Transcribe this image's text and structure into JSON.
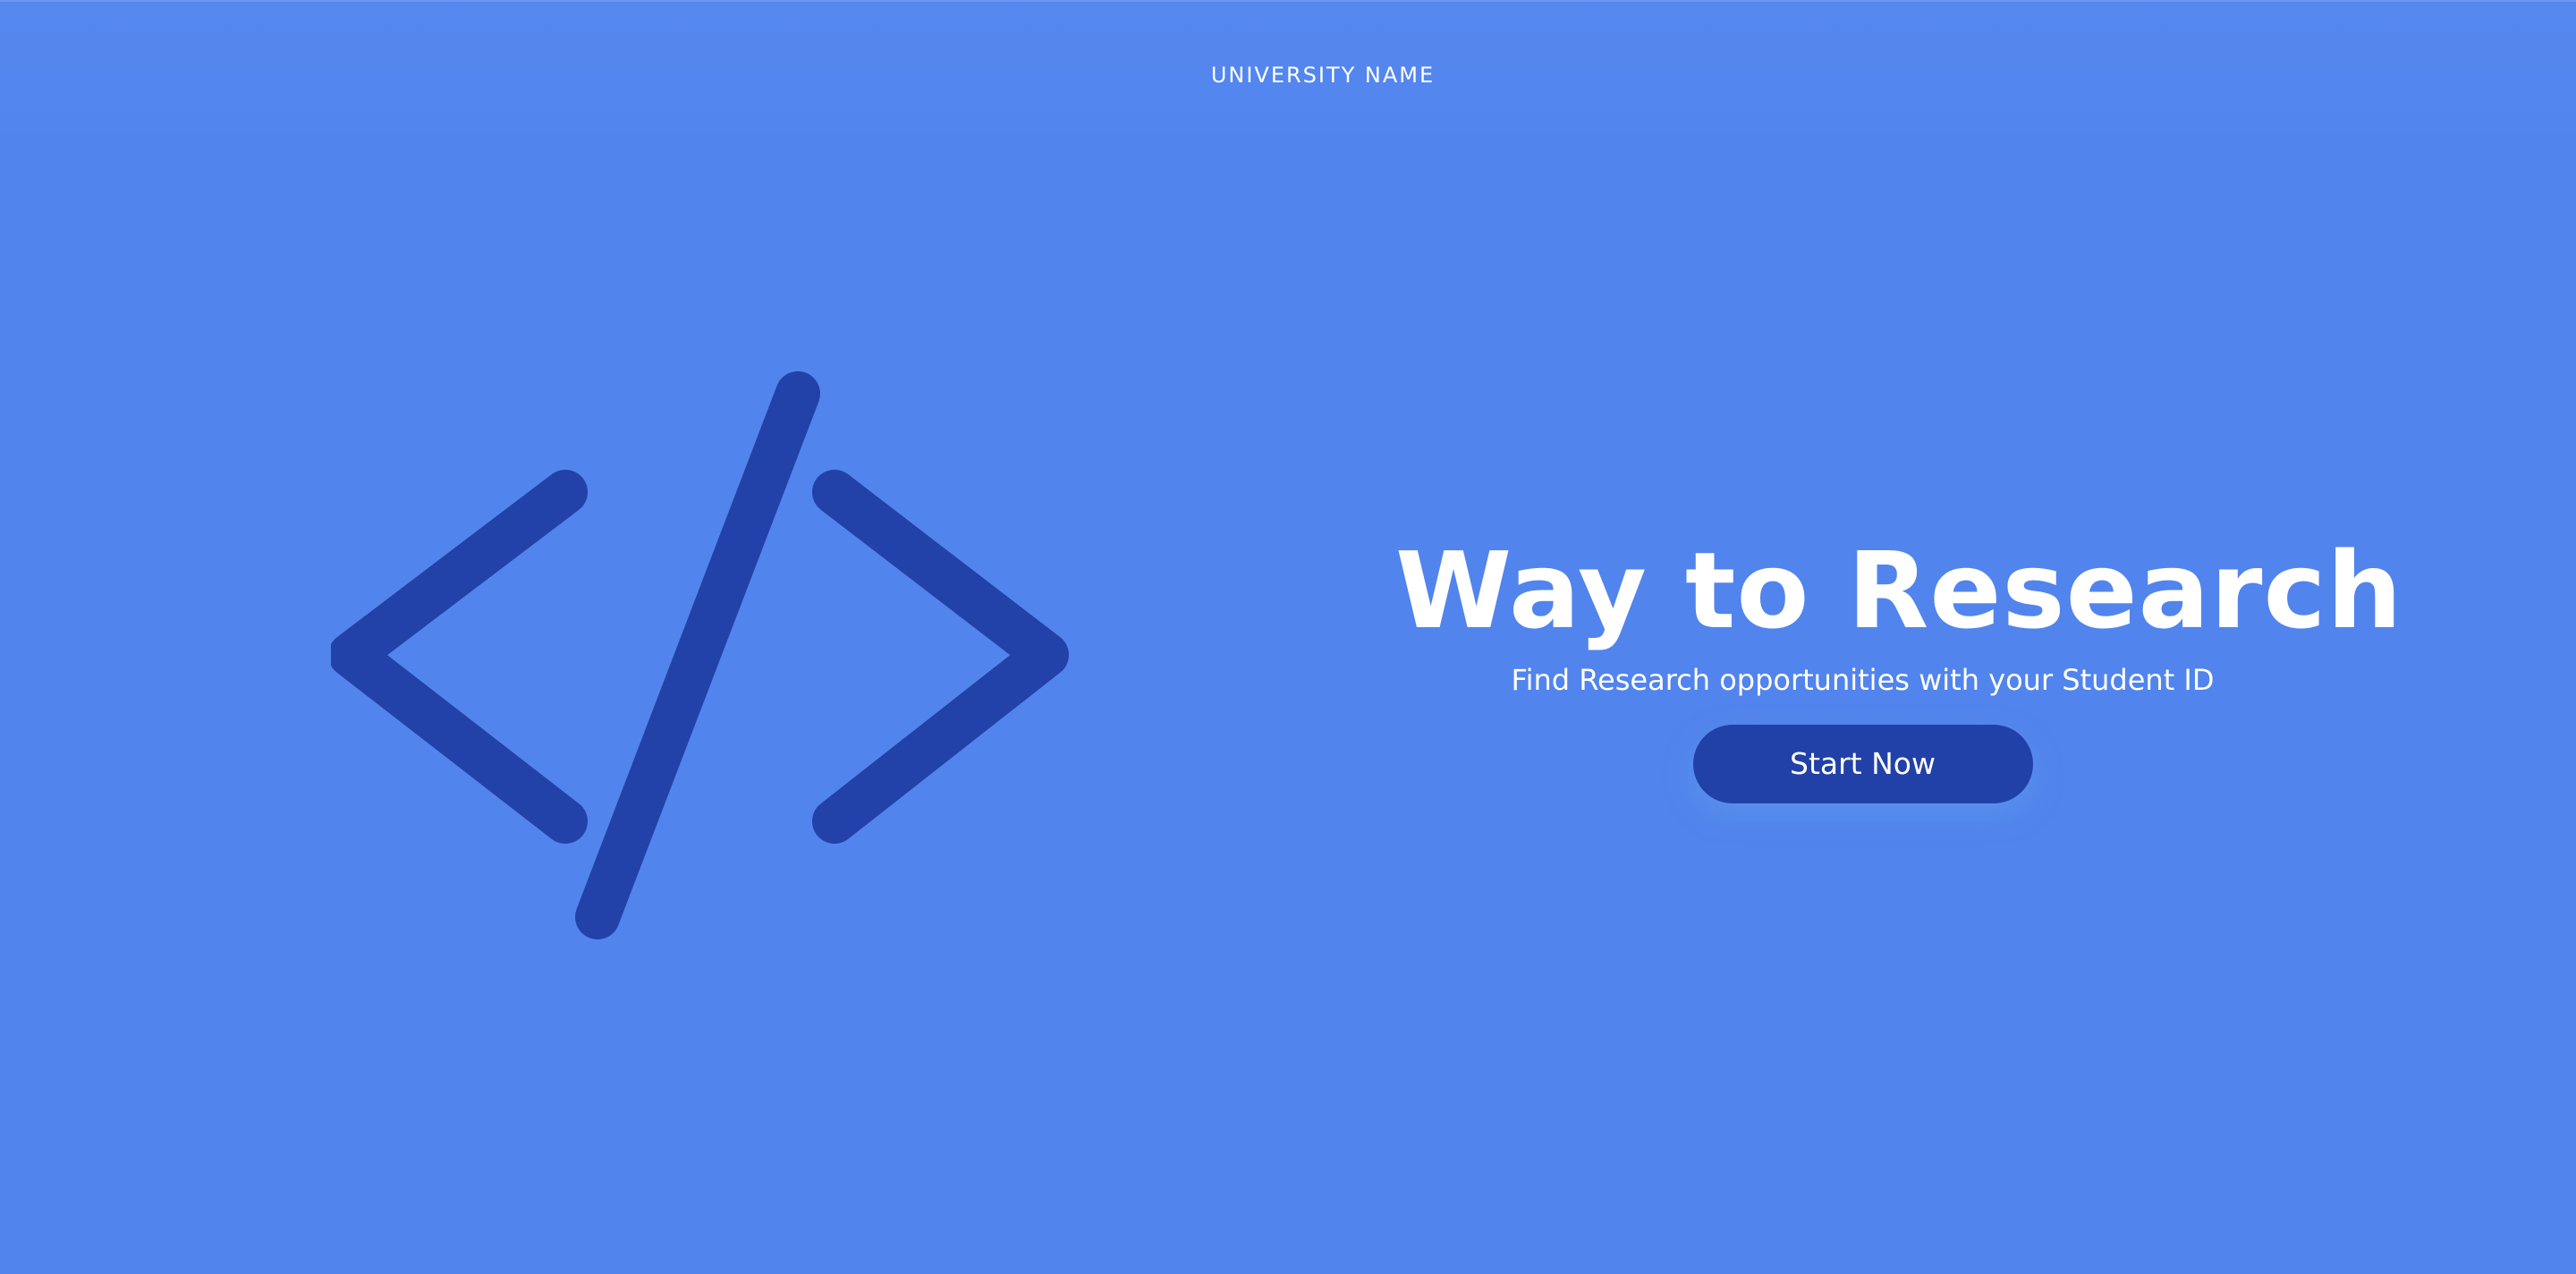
{
  "header": {
    "brand": "UNIVERSITY NAME"
  },
  "hero": {
    "logo_icon": "code-brackets-icon",
    "title": "Way to Research",
    "subtitle": "Find Research opportunities with your Student ID",
    "cta_label": "Start Now"
  },
  "colors": {
    "background": "#5284ed",
    "accent": "#2241a8",
    "text": "#ffffff"
  }
}
